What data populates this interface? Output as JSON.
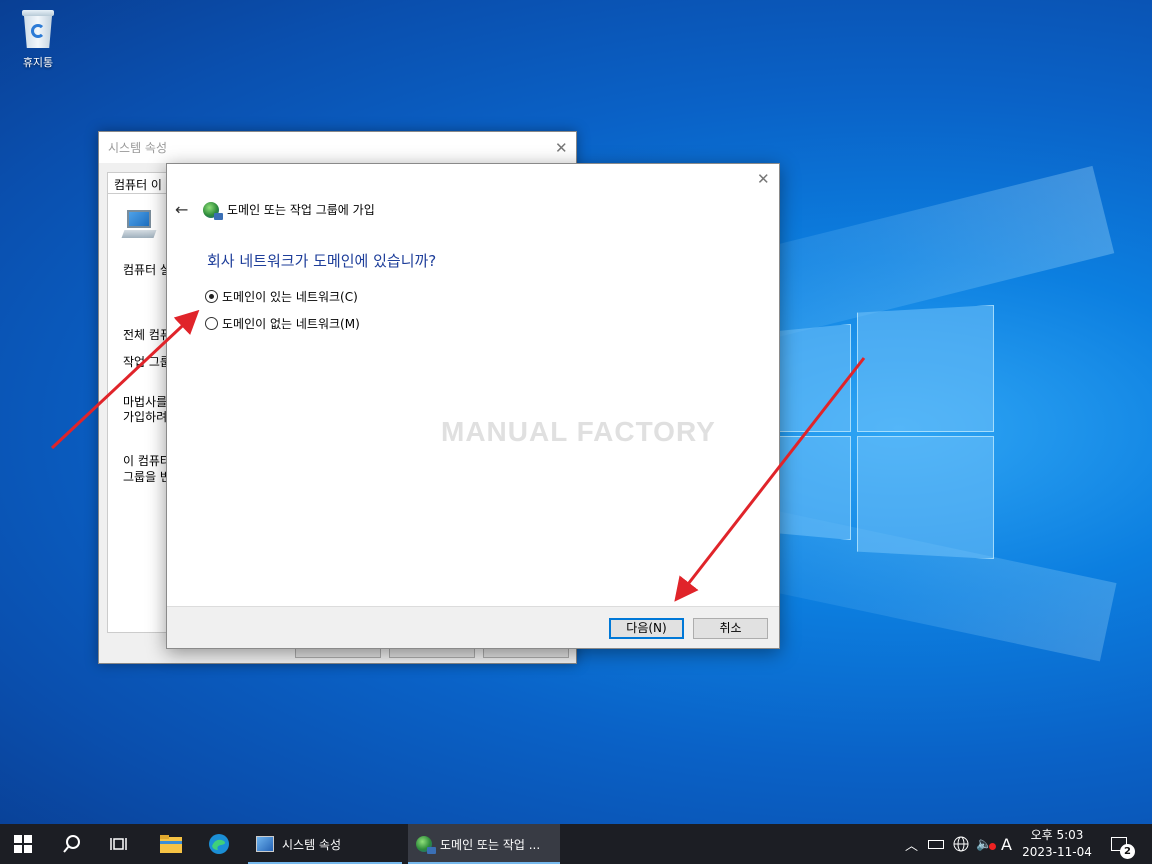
{
  "desktop": {
    "recycle_bin_label": "휴지통",
    "watermark": "MANUAL FACTORY"
  },
  "system_properties": {
    "title": "시스템 속성",
    "tab_label": "컴퓨터 이",
    "lines": [
      "컴퓨터 설",
      "전체 컴퓨",
      "작업 그룹",
      "마법사를",
      "가입하려",
      "이 컴퓨터",
      "그룹을 변"
    ]
  },
  "join_dialog": {
    "header_title": "도메인 또는 작업 그룹에 가입",
    "question": "회사 네트워크가 도메인에 있습니까?",
    "options": [
      {
        "label": "도메인이 있는 네트워크(C)",
        "selected": true
      },
      {
        "label": "도메인이 없는 네트워크(M)",
        "selected": false
      }
    ],
    "next_button": "다음(N)",
    "cancel_button": "취소"
  },
  "taskbar": {
    "apps": [
      {
        "label": "시스템 속성",
        "icon": "system-properties-icon"
      },
      {
        "label": "도메인 또는 작업 ...",
        "icon": "domain-join-icon"
      }
    ],
    "ime_indicator": "A",
    "clock_period_time": "오후 5:03",
    "clock_date": "2023-11-04",
    "notification_count": "2"
  },
  "annotations": {
    "arrow_color": "#e0242a"
  }
}
